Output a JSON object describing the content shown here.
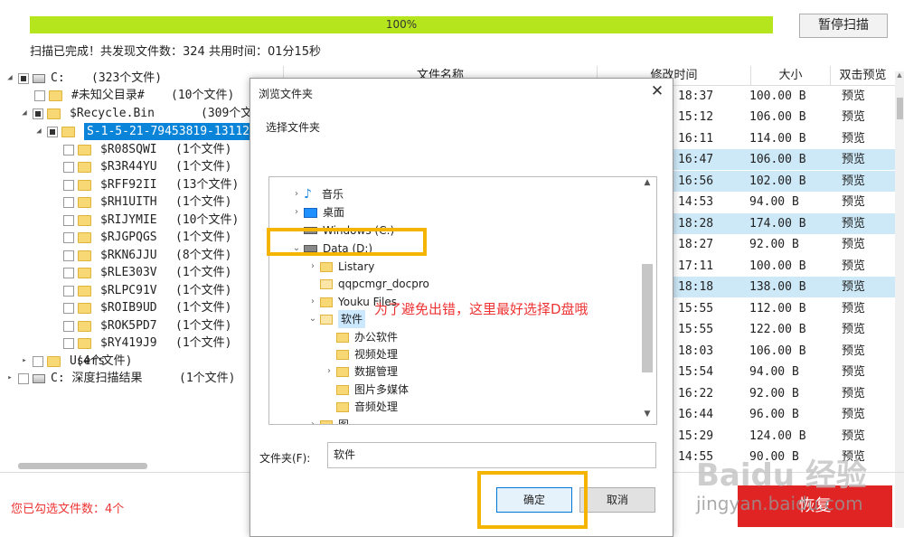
{
  "progress": {
    "value_percent": 100,
    "label": "100%"
  },
  "pause_button": "暂停扫描",
  "scan_status": "扫描已完成！共发现文件数：324  共用时间：01分15秒",
  "tree": [
    {
      "name": "C:",
      "count": "(323个文件)"
    },
    {
      "name": "#未知父目录#",
      "count": "(10个文件)"
    },
    {
      "name": "$Recycle.Bin",
      "count": "(309个文件)"
    },
    {
      "name": "S-1-5-21-79453819-131122",
      "count": ""
    },
    {
      "name": "$R08SQWI",
      "count": "(1个文件)"
    },
    {
      "name": "$R3R44YU",
      "count": "(1个文件)"
    },
    {
      "name": "$RFF92II",
      "count": "(13个文件)"
    },
    {
      "name": "$RH1UITH",
      "count": "(1个文件)"
    },
    {
      "name": "$RIJYMIE",
      "count": "(10个文件)"
    },
    {
      "name": "$RJGPQGS",
      "count": "(1个文件)"
    },
    {
      "name": "$RKN6JJU",
      "count": "(8个文件)"
    },
    {
      "name": "$RLE303V",
      "count": "(1个文件)"
    },
    {
      "name": "$RLPC91V",
      "count": "(1个文件)"
    },
    {
      "name": "$ROIB9UD",
      "count": "(1个文件)"
    },
    {
      "name": "$ROK5PD7",
      "count": "(1个文件)"
    },
    {
      "name": "$RY419J9",
      "count": "(1个文件)"
    },
    {
      "name": "Users",
      "count": "(4个文件)"
    },
    {
      "name": "C: 深度扫描结果",
      "count": "(1个文件)"
    }
  ],
  "table": {
    "headers": {
      "name": "文件名称",
      "mtime": "修改时间",
      "size": "大小",
      "preview": "双击预览"
    },
    "rows": [
      {
        "time": "18:37",
        "size": "100.00 B",
        "preview": "预览"
      },
      {
        "time": "15:12",
        "size": "106.00 B",
        "preview": "预览"
      },
      {
        "time": "16:11",
        "size": "114.00 B",
        "preview": "预览"
      },
      {
        "time": "16:47",
        "size": "106.00 B",
        "preview": "预览"
      },
      {
        "time": "16:56",
        "size": "102.00 B",
        "preview": "预览"
      },
      {
        "time": "14:53",
        "size": "94.00 B",
        "preview": "预览"
      },
      {
        "time": "18:28",
        "size": "174.00 B",
        "preview": "预览"
      },
      {
        "time": "18:27",
        "size": "92.00 B",
        "preview": "预览"
      },
      {
        "time": "17:11",
        "size": "100.00 B",
        "preview": "预览"
      },
      {
        "time": "18:18",
        "size": "138.00 B",
        "preview": "预览"
      },
      {
        "time": "15:55",
        "size": "112.00 B",
        "preview": "预览"
      },
      {
        "time": "15:55",
        "size": "122.00 B",
        "preview": "预览"
      },
      {
        "time": "18:03",
        "size": "106.00 B",
        "preview": "预览"
      },
      {
        "time": "15:54",
        "size": "94.00 B",
        "preview": "预览"
      },
      {
        "time": "16:22",
        "size": "92.00 B",
        "preview": "预览"
      },
      {
        "time": "16:44",
        "size": "96.00 B",
        "preview": "预览"
      },
      {
        "time": "15:29",
        "size": "124.00 B",
        "preview": "预览"
      },
      {
        "time": "14:55",
        "size": "90.00 B",
        "preview": "预览"
      }
    ]
  },
  "selected_count": "您已勾选文件数：4个",
  "restore_button": "恢复",
  "dialog": {
    "title": "浏览文件夹",
    "subtitle": "选择文件夹",
    "nodes": {
      "music": "音乐",
      "desktop": "桌面",
      "windows": "Windows (C:)",
      "data": "Data (D:)",
      "listary": "Listary",
      "qqpc": "qqpcmgr_docpro",
      "youku": "Youku Files",
      "software": "软件",
      "office": "办公软件",
      "video": "视频处理",
      "dataman": "数据管理",
      "image": "图片多媒体",
      "audio": "音频处理",
      "pic": "图"
    },
    "annotation": "为了避免出错，这里最好选择D盘哦",
    "folder_label": "文件夹(F):",
    "folder_value": "软件",
    "ok": "确定",
    "cancel": "取消"
  },
  "watermark": {
    "logo": "Baidu 经验",
    "url": "jingyan.baidu.com"
  },
  "colors": {
    "progress": "#b5e61d",
    "selection": "#0a84d8",
    "row_highlight": "#cde8f7",
    "restore": "#e02424",
    "annotation": "#e33333",
    "highlight_box": "#f5b400"
  }
}
